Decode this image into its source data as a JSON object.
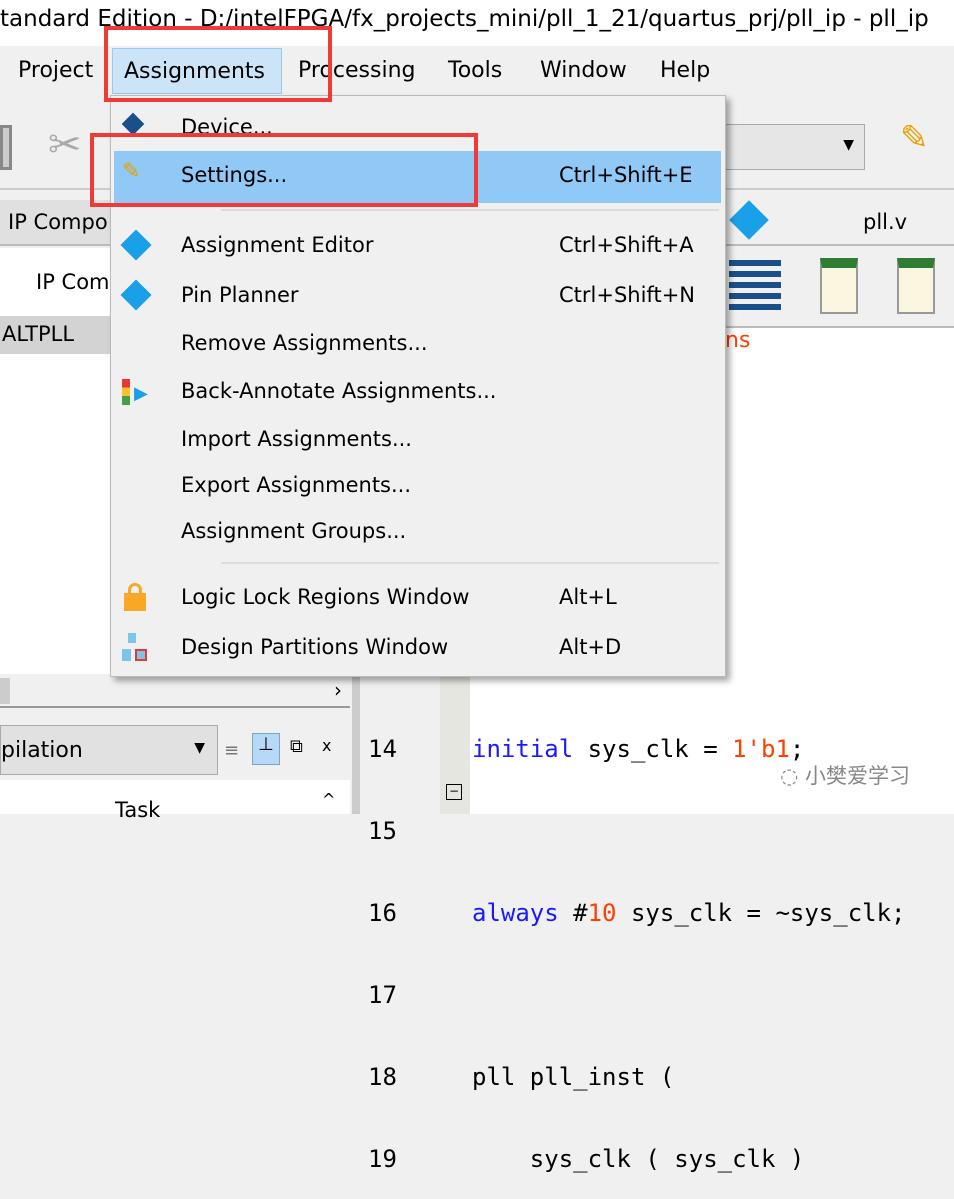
{
  "title": "tandard Edition - D:/intelFPGA/fx_projects_mini/pll_1_21/quartus_prj/pll_ip - pll_ip",
  "menubar": [
    "Project",
    "Assignments",
    "Processing",
    "Tools",
    "Window",
    "Help"
  ],
  "menu": {
    "items": [
      {
        "label": "Device...",
        "shortcut": "",
        "icon": "device-icon"
      },
      {
        "label": "Settings...",
        "shortcut": "Ctrl+Shift+E",
        "icon": "settings-pencil-icon",
        "highlighted": true
      },
      {
        "label": "Assignment Editor",
        "shortcut": "Ctrl+Shift+A",
        "icon": "assignment-editor-icon"
      },
      {
        "label": "Pin Planner",
        "shortcut": "Ctrl+Shift+N",
        "icon": "pin-planner-icon"
      },
      {
        "label": "Remove Assignments...",
        "shortcut": ""
      },
      {
        "label": "Back-Annotate Assignments...",
        "shortcut": "",
        "icon": "back-annotate-icon"
      },
      {
        "label": "Import Assignments...",
        "shortcut": ""
      },
      {
        "label": "Export Assignments...",
        "shortcut": ""
      },
      {
        "label": "Assignment Groups...",
        "shortcut": ""
      },
      {
        "label": "Logic Lock Regions Window",
        "shortcut": "Alt+L",
        "icon": "lock-icon"
      },
      {
        "label": "Design Partitions Window",
        "shortcut": "Alt+D",
        "icon": "partitions-icon"
      }
    ]
  },
  "left": {
    "tab": "IP Compo",
    "header": "IP Com",
    "row": "ALTPLL",
    "combo": "pilation",
    "task": "Task"
  },
  "editor": {
    "tab": "pll.v",
    "fragment": "ns",
    "lines": [
      {
        "n": "14",
        "text": "initial sys_clk = 1'b1;"
      },
      {
        "n": "15",
        "text": ""
      },
      {
        "n": "16",
        "text": "always #10 sys_clk = ~sys_clk;"
      },
      {
        "n": "17",
        "text": ""
      },
      {
        "n": "18",
        "text": "pll pll_inst ("
      },
      {
        "n": "19",
        "text": "    sys_clk ( sys_clk )"
      }
    ]
  },
  "watermark": "小樊爱学习",
  "colors": {
    "highlight": "#90c8f6",
    "annotation": "#f03a3a",
    "keyword": "#1a1aff",
    "number": "#ff4000"
  }
}
